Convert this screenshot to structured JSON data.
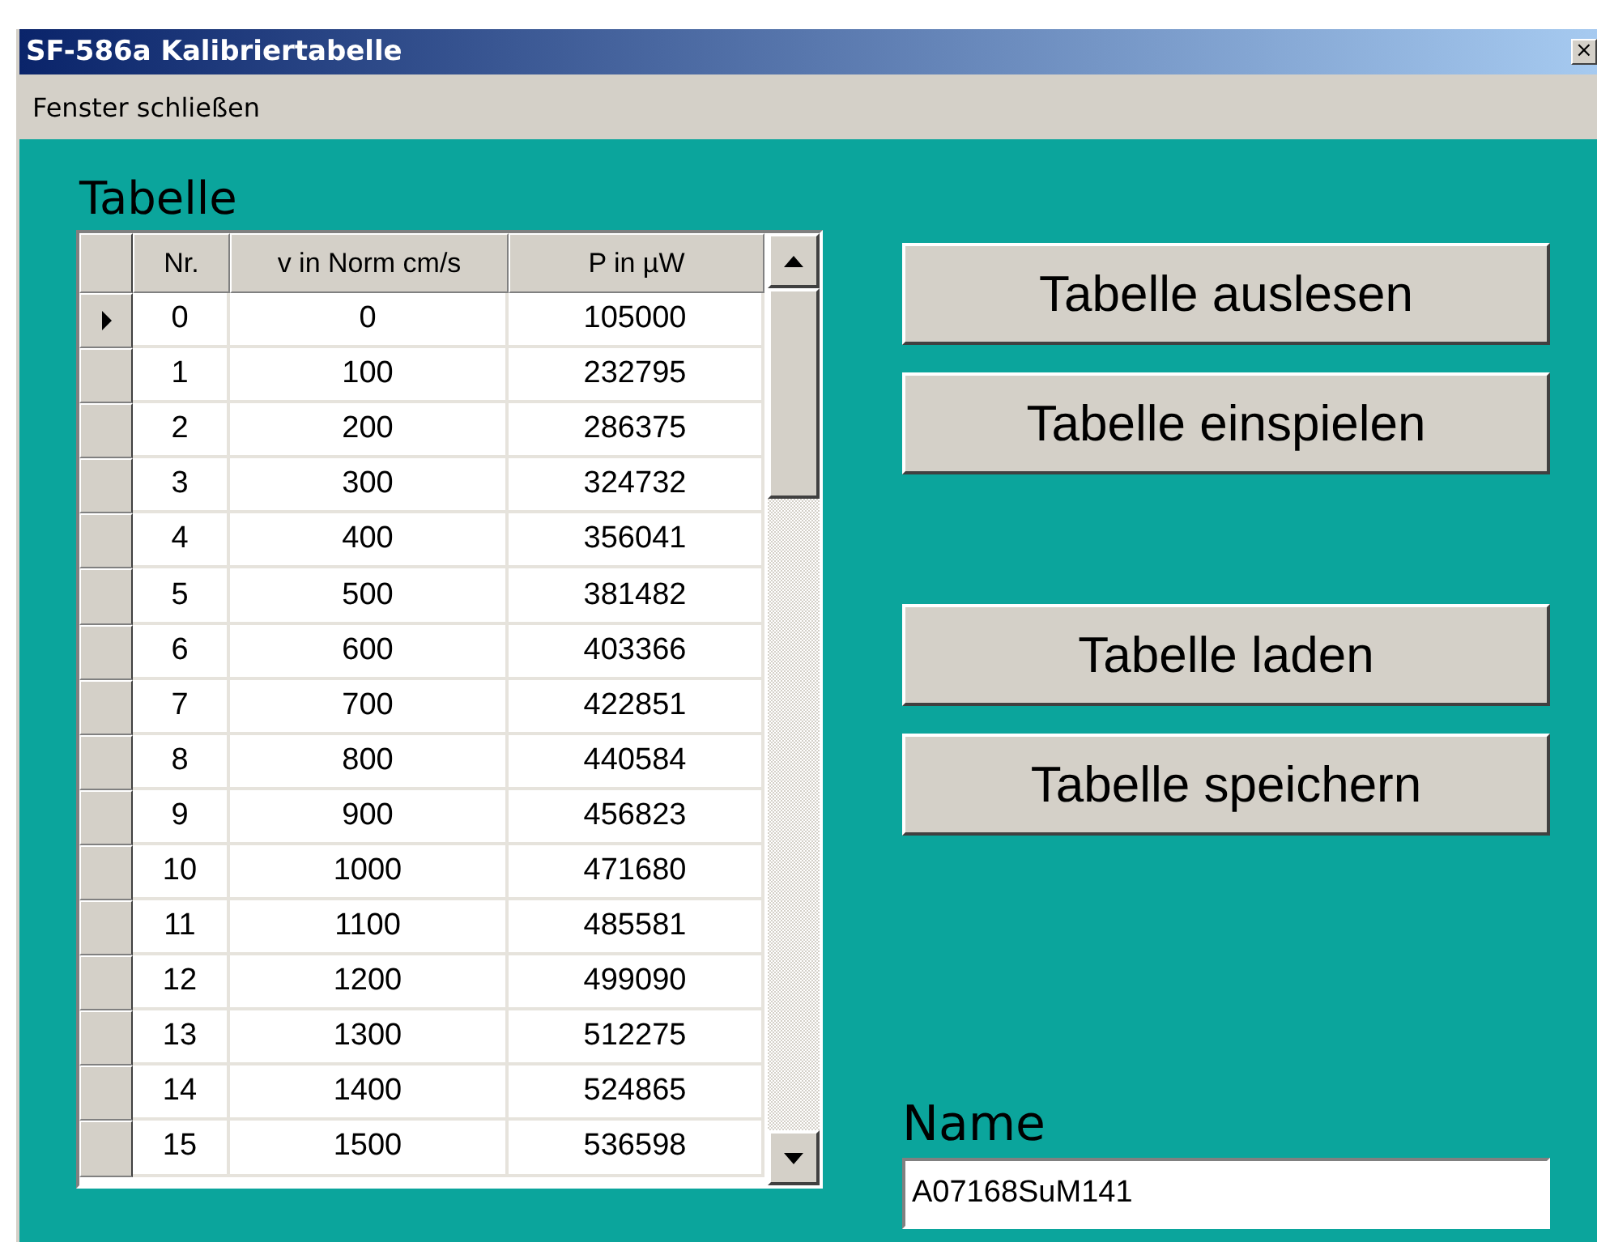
{
  "window": {
    "title": "SF-586a Kalibriertabelle",
    "close": "×"
  },
  "menu": [
    "Fenster schließen"
  ],
  "table_title": "Tabelle",
  "table": {
    "columns": [
      "Nr.",
      "v in Norm cm/s",
      "P in µW"
    ],
    "rows": [
      {
        "cells": [
          "0",
          "0",
          "105000"
        ],
        "selected": true
      },
      {
        "cells": [
          "1",
          "100",
          "232795"
        ],
        "selected": false
      },
      {
        "cells": [
          "2",
          "200",
          "286375"
        ],
        "selected": false
      },
      {
        "cells": [
          "3",
          "300",
          "324732"
        ],
        "selected": false
      },
      {
        "cells": [
          "4",
          "400",
          "356041"
        ],
        "selected": false
      },
      {
        "cells": [
          "5",
          "500",
          "381482"
        ],
        "selected": false
      },
      {
        "cells": [
          "6",
          "600",
          "403366"
        ],
        "selected": false
      },
      {
        "cells": [
          "7",
          "700",
          "422851"
        ],
        "selected": false
      },
      {
        "cells": [
          "8",
          "800",
          "440584"
        ],
        "selected": false
      },
      {
        "cells": [
          "9",
          "900",
          "456823"
        ],
        "selected": false
      },
      {
        "cells": [
          "10",
          "1000",
          "471680"
        ],
        "selected": false
      },
      {
        "cells": [
          "11",
          "1100",
          "485581"
        ],
        "selected": false
      },
      {
        "cells": [
          "12",
          "1200",
          "499090"
        ],
        "selected": false
      },
      {
        "cells": [
          "13",
          "1300",
          "512275"
        ],
        "selected": false
      },
      {
        "cells": [
          "14",
          "1400",
          "524865"
        ],
        "selected": false
      },
      {
        "cells": [
          "15",
          "1500",
          "536598"
        ],
        "selected": false
      }
    ]
  },
  "button_groups": [
    [
      "Tabelle auslesen",
      "Tabelle einspielen"
    ],
    [
      "Tabelle laden",
      "Tabelle speichern"
    ]
  ],
  "name_label": "Name",
  "name_field": {
    "value": "A07168SuM141"
  }
}
